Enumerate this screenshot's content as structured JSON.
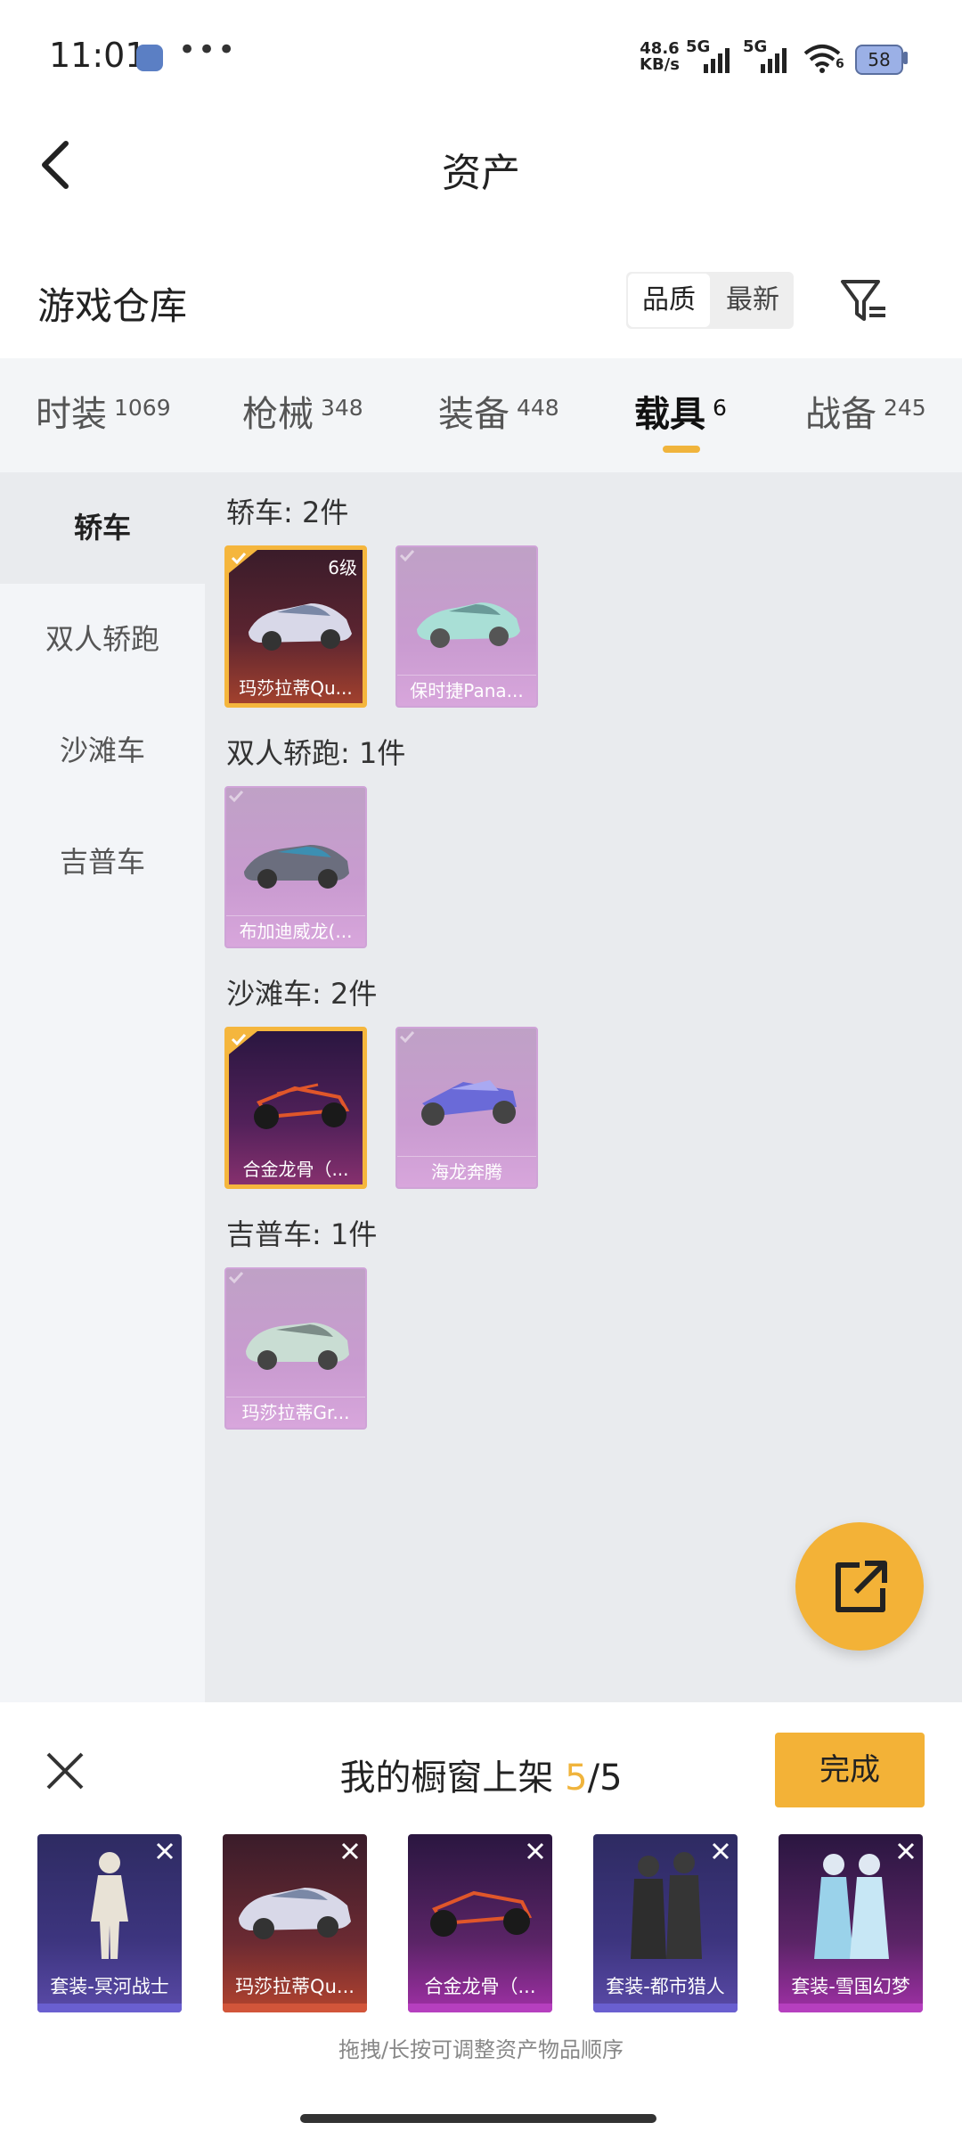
{
  "status_bar": {
    "time": "11:01",
    "more": "•••",
    "speed_top": "48.6",
    "speed_bottom": "KB/s",
    "net1": "5G",
    "net2": "5G",
    "wifi_num": "6",
    "battery": "58"
  },
  "header": {
    "title": "资产"
  },
  "warehouse": {
    "label": "游戏仓库",
    "sort_quality": "品质",
    "sort_newest": "最新"
  },
  "tabs": [
    {
      "label": "时装",
      "count": "1069"
    },
    {
      "label": "枪械",
      "count": "348"
    },
    {
      "label": "装备",
      "count": "448"
    },
    {
      "label": "载具",
      "count": "6"
    },
    {
      "label": "战备",
      "count": "245"
    }
  ],
  "sidebar": [
    "轿车",
    "双人轿跑",
    "沙滩车",
    "吉普车"
  ],
  "groups": {
    "sedan": {
      "title": "轿车: 2件",
      "items": [
        "玛莎拉蒂Qu...",
        "保时捷Pana..."
      ],
      "level": "6级"
    },
    "coupe": {
      "title": "双人轿跑: 1件",
      "items": [
        "布加迪威龙(..."
      ]
    },
    "beach": {
      "title": "沙滩车: 2件",
      "items": [
        "合金龙骨（...",
        "海龙奔腾"
      ]
    },
    "jeep": {
      "title": "吉普车: 1件",
      "items": [
        "玛莎拉蒂Gr..."
      ]
    }
  },
  "showcase": {
    "title_prefix": "我的橱窗上架 ",
    "count": "5",
    "total": "/5",
    "done": "完成",
    "slots": [
      "套装-冥河战士",
      "玛莎拉蒂Qu...",
      "合金龙骨（...",
      "套装-都市猎人",
      "套装-雪国幻梦"
    ],
    "hint": "拖拽/长按可调整资产物品顺序"
  },
  "colors": {
    "accent": "#f3b237",
    "underline": "#f0b43c"
  }
}
